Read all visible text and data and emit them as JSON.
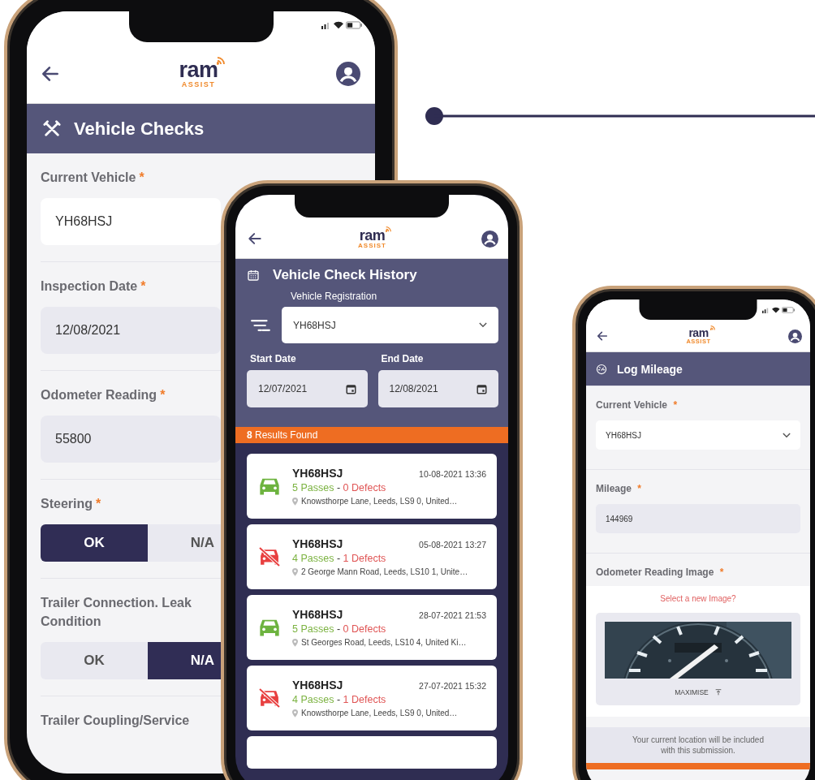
{
  "vehicle_checks": {
    "logo": {
      "name": "ram",
      "tagline": "ASSIST"
    },
    "title": "Vehicle Checks",
    "sections": [
      {
        "kind": "select",
        "label": "Current Vehicle",
        "mark": "*",
        "value": "YH68HSJ"
      },
      {
        "kind": "input",
        "label": "Inspection Date",
        "mark": "*",
        "value": "12/08/2021"
      },
      {
        "kind": "input",
        "label": "Odometer Reading",
        "mark": "*",
        "value": "55800"
      },
      {
        "kind": "toggle",
        "label": "Steering",
        "mark": "*",
        "options": [
          {
            "label": "OK",
            "selected": true
          },
          {
            "label": "N/A",
            "selected": false
          }
        ]
      },
      {
        "kind": "toggle",
        "label": "Trailer Connection. Leak",
        "label_cont": "Condition",
        "options": [
          {
            "label": "OK",
            "selected": false
          },
          {
            "label": "N/A",
            "selected": true
          }
        ]
      },
      {
        "kind": "heading",
        "label": "Trailer Coupling/Service"
      }
    ]
  },
  "check_history": {
    "logo": {
      "name": "ram",
      "tagline": "ASSIST"
    },
    "title": "Vehicle Check History",
    "registration": {
      "label": "Vehicle Registration",
      "value": "YH68HSJ"
    },
    "dates": [
      {
        "label": "Start Date",
        "value": "12/07/2021"
      },
      {
        "label": "End Date",
        "value": "12/08/2021"
      }
    ],
    "results": {
      "count": "8",
      "label": "Results Found"
    },
    "checks": [
      {
        "kind": "pass",
        "registration": "YH68HSJ",
        "datetime": "10-08-2021 13:36",
        "passes": "5 Passes",
        "separator": "-",
        "defects": "0 Defects",
        "address": "Knowsthorpe Lane, Leeds, LS9 0, United…"
      },
      {
        "kind": "defect",
        "registration": "YH68HSJ",
        "datetime": "05-08-2021 13:27",
        "passes": "4 Passes",
        "separator": "-",
        "defects": "1 Defects",
        "address": "2 George Mann Road, Leeds, LS10 1, Unite…"
      },
      {
        "kind": "pass",
        "registration": "YH68HSJ",
        "datetime": "28-07-2021 21:53",
        "passes": "5 Passes",
        "separator": "-",
        "defects": "0 Defects",
        "address": "St Georges Road, Leeds, LS10 4, United Ki…"
      },
      {
        "kind": "defect",
        "registration": "YH68HSJ",
        "datetime": "27-07-2021 15:32",
        "passes": "4 Passes",
        "separator": "-",
        "defects": "1 Defects",
        "address": "Knowsthorpe Lane, Leeds, LS9 0, United…"
      }
    ]
  },
  "log_mileage": {
    "logo": {
      "name": "ram",
      "tagline": "ASSIST"
    },
    "title": "Log Mileage",
    "vehicle": {
      "label": "Current Vehicle",
      "mark": "*",
      "value": "YH68HSJ"
    },
    "mileage": {
      "label": "Mileage",
      "mark": "*",
      "value": "144969"
    },
    "image": {
      "label": "Odometer Reading Image",
      "mark": "*",
      "link": "Select a new Image?",
      "action": "MAXIMISE",
      "kind": "picture"
    },
    "notice": "Your current location will be included with this submission."
  }
}
